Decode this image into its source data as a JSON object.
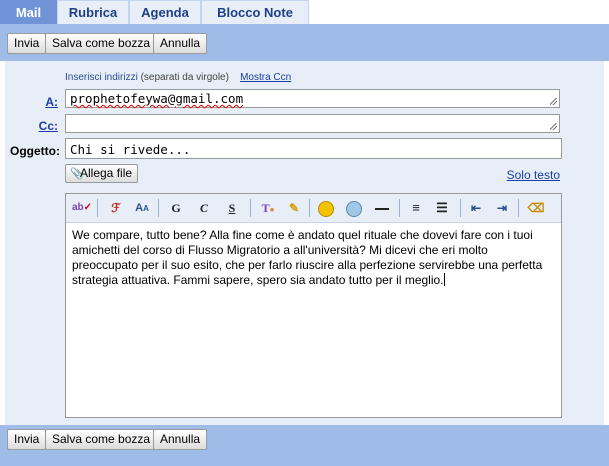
{
  "tabs": [
    {
      "label": "Mail",
      "active": true
    },
    {
      "label": "Rubrica",
      "active": false
    },
    {
      "label": "Agenda",
      "active": false
    },
    {
      "label": "Blocco Note",
      "active": false
    }
  ],
  "toolbar": {
    "send": "Invia",
    "save_draft": "Salva come bozza",
    "cancel": "Annulla"
  },
  "compose": {
    "hint_insert": "Inserisci indirizzi",
    "hint_sep": "(separati da virgole)",
    "show_cc": "Mostra Ccn",
    "to_label": "A:",
    "to_value": "prophetofeywa@gmail.com",
    "cc_label": "Cc:",
    "cc_value": "",
    "subject_label": "Oggetto:",
    "subject_value": "Chi si rivede...",
    "attach_label": "Allega file",
    "plain_text_link": "Solo testo"
  },
  "editor": {
    "toolbar_icons": [
      "spellcheck-icon",
      "font-icon",
      "font-size-icon",
      "bold-icon",
      "italic-icon",
      "underline-icon",
      "text-color-icon",
      "highlight-icon",
      "emoticon-smile-icon",
      "emoticon-icon",
      "horizontal-rule-icon",
      "align-icon",
      "list-icon",
      "outdent-icon",
      "indent-icon",
      "remove-format-icon"
    ],
    "glyphs": {
      "bold": "G",
      "italic": "C",
      "underline": "S"
    },
    "body": "We compare, tutto bene? Alla fine come è andato quel rituale che dovevi fare con i tuoi amichetti del corso di Flusso Migratorio a all'università? Mi dicevi che eri molto preoccupato per il suo esito, che per farlo riuscire alla perfezione servirebbe una perfetta strategia attuativa. Fammi sapere, spero sia andato tutto per il meglio."
  },
  "colors": {
    "accent_bar": "#9fbbe8",
    "panel": "#e8eef7",
    "active_tab": "#6f93d6",
    "link": "#1a3ea6"
  }
}
